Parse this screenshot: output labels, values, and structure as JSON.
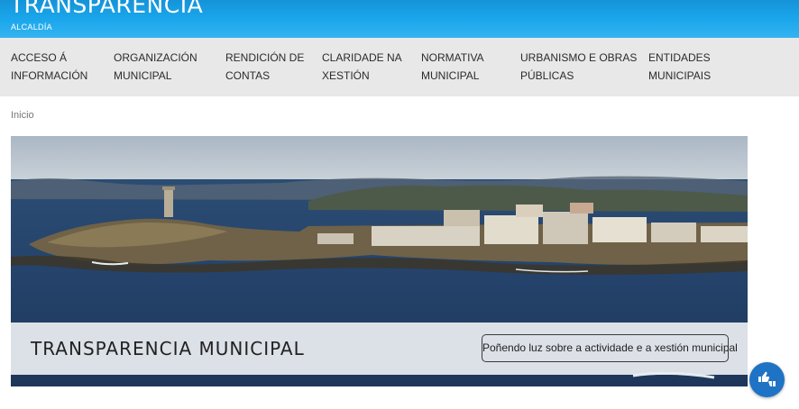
{
  "header": {
    "title": "TRANSPARENCIA",
    "subtitle": "ALCALDÍA"
  },
  "nav": {
    "items": [
      {
        "line1": "ACCESO Á",
        "line2": "INFORMACIÓN"
      },
      {
        "line1": "ORGANIZACIÓN",
        "line2": "MUNICIPAL"
      },
      {
        "line1": "RENDICIÓN DE",
        "line2": "CONTAS"
      },
      {
        "line1": "CLARIDADE NA",
        "line2": "XESTIÓN"
      },
      {
        "line1": "NORMATIVA",
        "line2": "MUNICIPAL"
      },
      {
        "line1": "URBANISMO E OBRAS",
        "line2": "PÚBLICAS"
      },
      {
        "line1": "ENTIDADES",
        "line2": "MUNICIPAIS"
      }
    ]
  },
  "breadcrumb": {
    "home": "Inicio"
  },
  "hero": {
    "title": "TRANSPARENCIA MUNICIPAL",
    "tagline": "Poñendo luz sobre a actividade e a xestión municipal"
  },
  "fab": {
    "icon": "thumbs-feedback-icon"
  },
  "colors": {
    "header_blue": "#1aa6ec",
    "nav_bg": "#e8e8e8",
    "fab_blue": "#1f73c4"
  }
}
